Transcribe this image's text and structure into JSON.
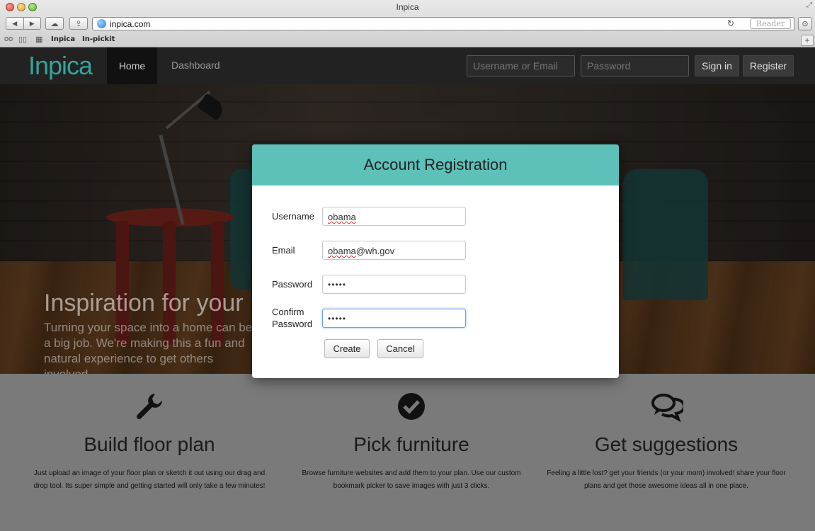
{
  "browser": {
    "window_title": "Inpica",
    "url": "inpica.com",
    "reader_label": "Reader",
    "bookmarks": [
      "Inpica",
      "In-pickit"
    ]
  },
  "navbar": {
    "brand": "Inpica",
    "home_label": "Home",
    "dashboard_label": "Dashboard",
    "username_placeholder": "Username or Email",
    "password_placeholder": "Password",
    "signin_label": "Sign in",
    "register_label": "Register"
  },
  "hero": {
    "title": "Inspiration for your",
    "text": "Turning your space into a home can be a big job. We're making this a fun and natural experience to get others involved."
  },
  "features": [
    {
      "icon": "wrench-icon",
      "title": "Build floor plan",
      "text": "Just upload an image of your floor plan or sketch it out using our drag and drop tool. Its super simple and getting started will only take a few minutes!"
    },
    {
      "icon": "check-circle-icon",
      "title": "Pick furniture",
      "text": "Browse furniture websites and add them to your plan. Use our custom bookmark picker to save images with just 3 clicks."
    },
    {
      "icon": "comments-icon",
      "title": "Get suggestions",
      "text": "Feeling a little lost? get your friends (or your mom) involved! share your floor plans and get those awesome ideas all in one place."
    }
  ],
  "modal": {
    "title": "Account Registration",
    "fields": {
      "username": {
        "label": "Username",
        "value": "obama"
      },
      "email": {
        "label": "Email",
        "value_user": "obama",
        "value_domain": "@wh.gov"
      },
      "password": {
        "label": "Password",
        "value": "•••••"
      },
      "confirm": {
        "label_line1": "Confirm",
        "label_line2": "Password",
        "value": "•••••"
      }
    },
    "create_label": "Create",
    "cancel_label": "Cancel"
  },
  "colors": {
    "brand": "#35a39b",
    "modal_header": "#5dc1ba",
    "navbar": "#222222"
  }
}
